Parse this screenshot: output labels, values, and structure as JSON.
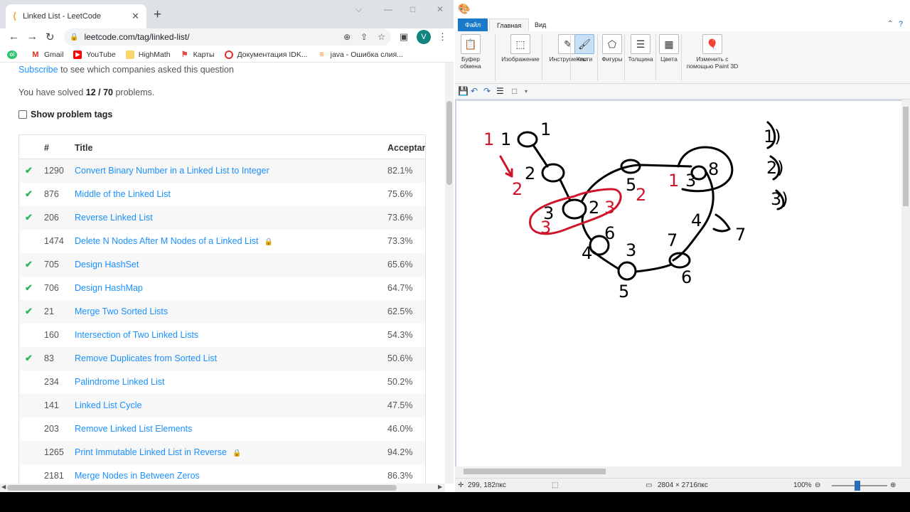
{
  "browser": {
    "tab_title": "Linked List - LeetCode",
    "url": "leetcode.com/tag/linked-list/",
    "avatar_letter": "V",
    "bookmarks": [
      "Gmail",
      "YouTube",
      "HighMath",
      "Карты",
      "Документация IDK...",
      "java - Ошибка слия..."
    ]
  },
  "page": {
    "subscribe_link": "Subscribe",
    "subscribe_text": " to see which companies asked this question",
    "solved_prefix": "You have solved ",
    "solved_value": "12 / 70",
    "solved_suffix": " problems.",
    "show_tags": "Show problem tags",
    "columns": [
      "#",
      "Title",
      "Acceptar"
    ],
    "rows": [
      {
        "solved": true,
        "num": "1290",
        "title": "Convert Binary Number in a Linked List to Integer",
        "locked": false,
        "acceptance": "82.1%"
      },
      {
        "solved": true,
        "num": "876",
        "title": "Middle of the Linked List",
        "locked": false,
        "acceptance": "75.6%"
      },
      {
        "solved": true,
        "num": "206",
        "title": "Reverse Linked List",
        "locked": false,
        "acceptance": "73.6%"
      },
      {
        "solved": false,
        "num": "1474",
        "title": "Delete N Nodes After M Nodes of a Linked List",
        "locked": true,
        "acceptance": "73.3%"
      },
      {
        "solved": true,
        "num": "705",
        "title": "Design HashSet",
        "locked": false,
        "acceptance": "65.6%"
      },
      {
        "solved": true,
        "num": "706",
        "title": "Design HashMap",
        "locked": false,
        "acceptance": "64.7%"
      },
      {
        "solved": true,
        "num": "21",
        "title": "Merge Two Sorted Lists",
        "locked": false,
        "acceptance": "62.5%"
      },
      {
        "solved": false,
        "num": "160",
        "title": "Intersection of Two Linked Lists",
        "locked": false,
        "acceptance": "54.3%"
      },
      {
        "solved": true,
        "num": "83",
        "title": "Remove Duplicates from Sorted List",
        "locked": false,
        "acceptance": "50.6%"
      },
      {
        "solved": false,
        "num": "234",
        "title": "Palindrome Linked List",
        "locked": false,
        "acceptance": "50.2%"
      },
      {
        "solved": false,
        "num": "141",
        "title": "Linked List Cycle",
        "locked": false,
        "acceptance": "47.5%"
      },
      {
        "solved": false,
        "num": "203",
        "title": "Remove Linked List Elements",
        "locked": false,
        "acceptance": "46.0%"
      },
      {
        "solved": false,
        "num": "1265",
        "title": "Print Immutable Linked List in Reverse",
        "locked": true,
        "acceptance": "94.2%"
      },
      {
        "solved": false,
        "num": "2181",
        "title": "Merge Nodes in Between Zeros",
        "locked": false,
        "acceptance": "86.3%"
      }
    ]
  },
  "paint": {
    "tabs": [
      "Файл",
      "Главная",
      "Вид"
    ],
    "groups": [
      {
        "label": "Буфер\nобмена",
        "icon": "clipboard-icon"
      },
      {
        "label": "Изображение",
        "icon": "image-icon"
      },
      {
        "label": "Инструменты",
        "icon": "tools-icon"
      },
      {
        "label": "Кисти",
        "icon": "brush-icon",
        "active": true
      },
      {
        "label": "Фигуры",
        "icon": "shapes-icon"
      },
      {
        "label": "Толщина",
        "icon": "thickness-icon"
      },
      {
        "label": "Цвета",
        "icon": "colors-icon"
      },
      {
        "label": "Изменить с\nпомощью Paint 3D",
        "icon": "paint3d-icon"
      }
    ],
    "status": {
      "cursor": "299, 182пкс",
      "size": "2804 × 2716пкс",
      "zoom": "100%"
    },
    "drawing_labels": [
      "1",
      "1",
      "1",
      "2",
      "2",
      "3",
      "2",
      "3",
      "3",
      "5",
      "2",
      "3",
      "8",
      "1",
      "6",
      "4",
      "3",
      "7",
      "4",
      "5",
      "6",
      "7",
      "1)",
      "2)",
      "3)"
    ]
  }
}
